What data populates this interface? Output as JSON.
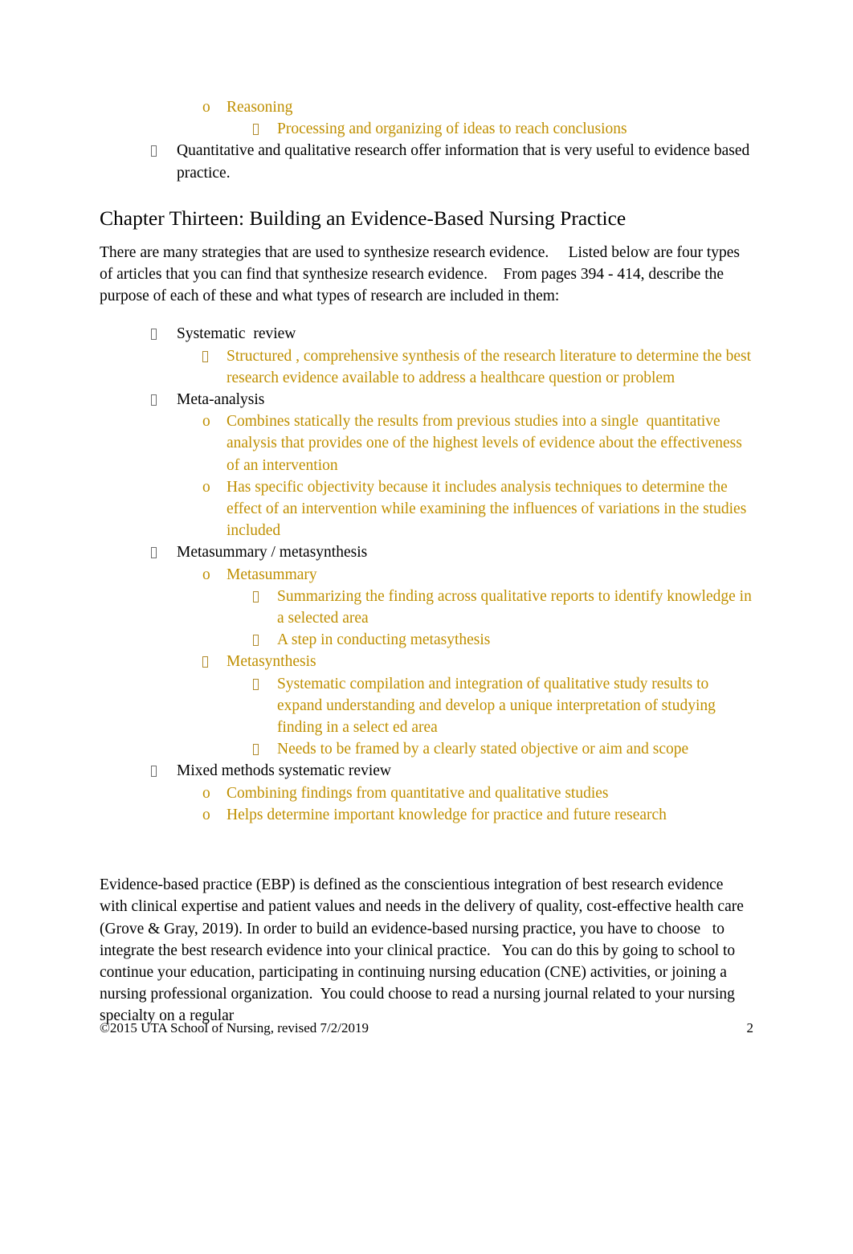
{
  "document": {
    "heading": "Chapter Thirteen: Building an Evidence-Based Nursing Practice",
    "intro_paragraph": "There are many strategies that are used to synthesize research evidence.     Listed below are four types of articles that you can find that synthesize research evidence.    From pages 394 - 414, describe the purpose of each of these and what types of research are included in them:",
    "closing_paragraph": "Evidence-based practice (EBP) is defined as the conscientious integration of best research evidence with clinical expertise and patient values and needs in the delivery of quality, cost-effective health care (Grove & Gray, 2019). In order to build an evidence-based nursing practice, you have to choose   to integrate the best research evidence into your clinical practice.   You can do this by going to school to continue your education, participating in continuing nursing education (CNE) activities, or joining a nursing professional organization.  You could choose to read a nursing journal related to your nursing specialty on a regular"
  },
  "top_list": {
    "reasoning_marker": "o",
    "reasoning_label": "Reasoning",
    "reasoning_detail": "Processing and organizing of ideas to reach conclusions",
    "quant_qual_item": "Quantitative and qualitative research offer information that is very useful to evidence based practice."
  },
  "article_types": [
    {
      "label": "Systematic  review",
      "children": [
        {
          "marker_type": "tofu",
          "text": "Structured , comprehensive synthesis of the research literature to determine the best research evidence available to address a healthcare question or problem"
        }
      ]
    },
    {
      "label": "Meta-analysis",
      "children": [
        {
          "marker_type": "o",
          "text": "Combines statically the results from previous studies into a single  quantitative analysis that provides one of the highest levels of evidence about the effectiveness of an intervention"
        },
        {
          "marker_type": "o",
          "text": "Has specific objectivity because it includes analysis techniques to determine the effect of an intervention while examining the influences of variations in the studies included"
        }
      ]
    },
    {
      "label": "Metasummary / metasynthesis",
      "children": [
        {
          "marker_type": "o",
          "text": "Metasummary",
          "grandchildren": [
            "Summarizing the finding across qualitative reports to identify knowledge in a selected area",
            "A step in conducting metasythesis"
          ]
        },
        {
          "marker_type": "tofu",
          "text": "Metasynthesis",
          "grandchildren": [
            "Systematic compilation and integration of qualitative study results to expand understanding and develop a unique interpretation of studying finding in a select ed area",
            "Needs to be framed by a clearly stated objective or aim and scope"
          ]
        }
      ]
    },
    {
      "label": "Mixed methods systematic review",
      "children": [
        {
          "marker_type": "o",
          "text": "Combining findings from quantitative and qualitative studies"
        },
        {
          "marker_type": "o",
          "text": "Helps determine important knowledge for practice and future research"
        }
      ]
    }
  ],
  "footer": {
    "copyright": "©2015 UTA School of Nursing, revised 7/2/2019",
    "page_number": "2"
  },
  "colors": {
    "answer_text": "#bf8f00",
    "body_text": "#000000",
    "background": "#ffffff"
  }
}
